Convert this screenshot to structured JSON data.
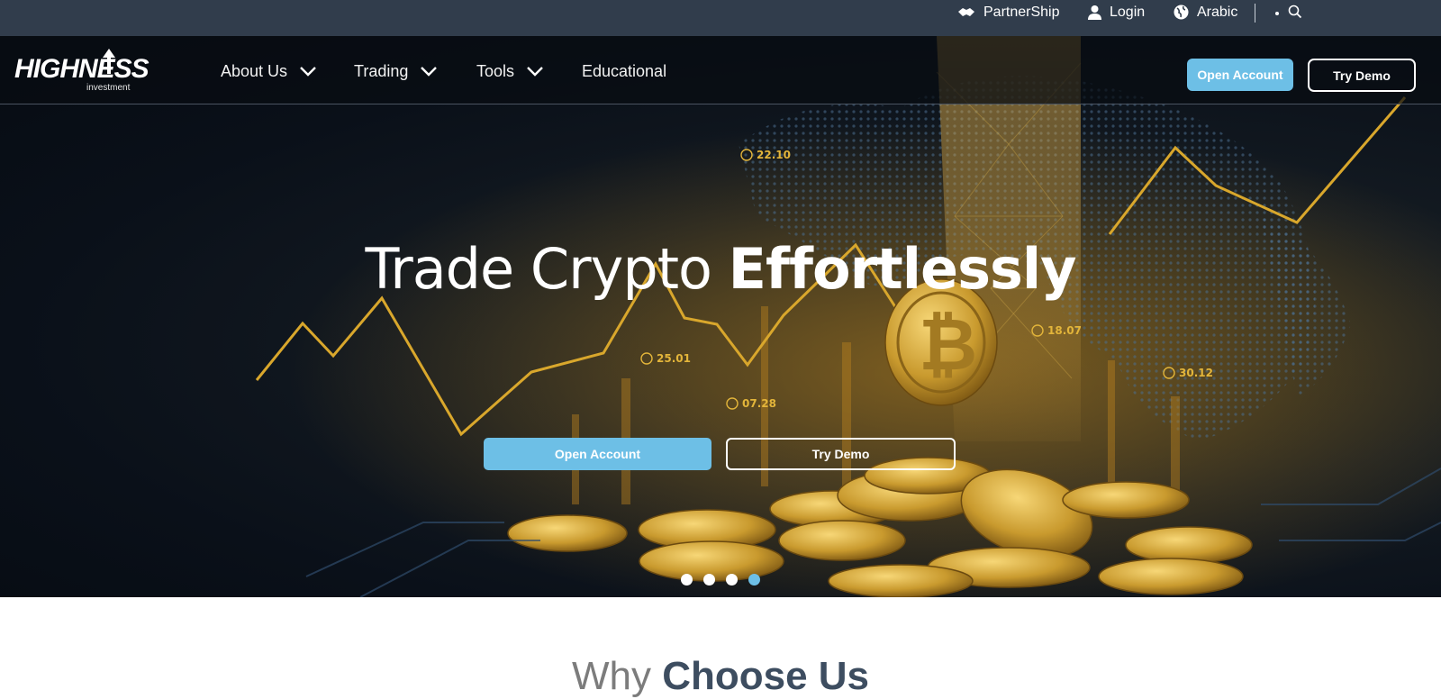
{
  "topbar": {
    "partnership": "PartnerShip",
    "login": "Login",
    "language": "Arabic"
  },
  "logo": {
    "brand": "HIGHNESS",
    "sub": "investment"
  },
  "nav": {
    "items": [
      {
        "label": "About Us",
        "has_dropdown": true
      },
      {
        "label": "Trading",
        "has_dropdown": true
      },
      {
        "label": "Tools",
        "has_dropdown": true
      },
      {
        "label": "Educational",
        "has_dropdown": false
      }
    ],
    "open_account": "Open Account",
    "try_demo": "Try Demo"
  },
  "hero": {
    "headline_regular": "Trade Crypto ",
    "headline_bold": "Effortlessly",
    "open_account": "Open Account",
    "try_demo": "Try Demo",
    "chart_labels": [
      "22.10",
      "25.01",
      "07.28",
      "18.07",
      "30.12"
    ],
    "slides_count": 4,
    "active_slide": 4
  },
  "why": {
    "regular": "Why ",
    "bold": "Choose Us"
  },
  "colors": {
    "accent": "#6dbfe6",
    "topbar_bg": "#313d4c",
    "heading_dark": "#3d4d60",
    "gold": "#d9a72c"
  }
}
